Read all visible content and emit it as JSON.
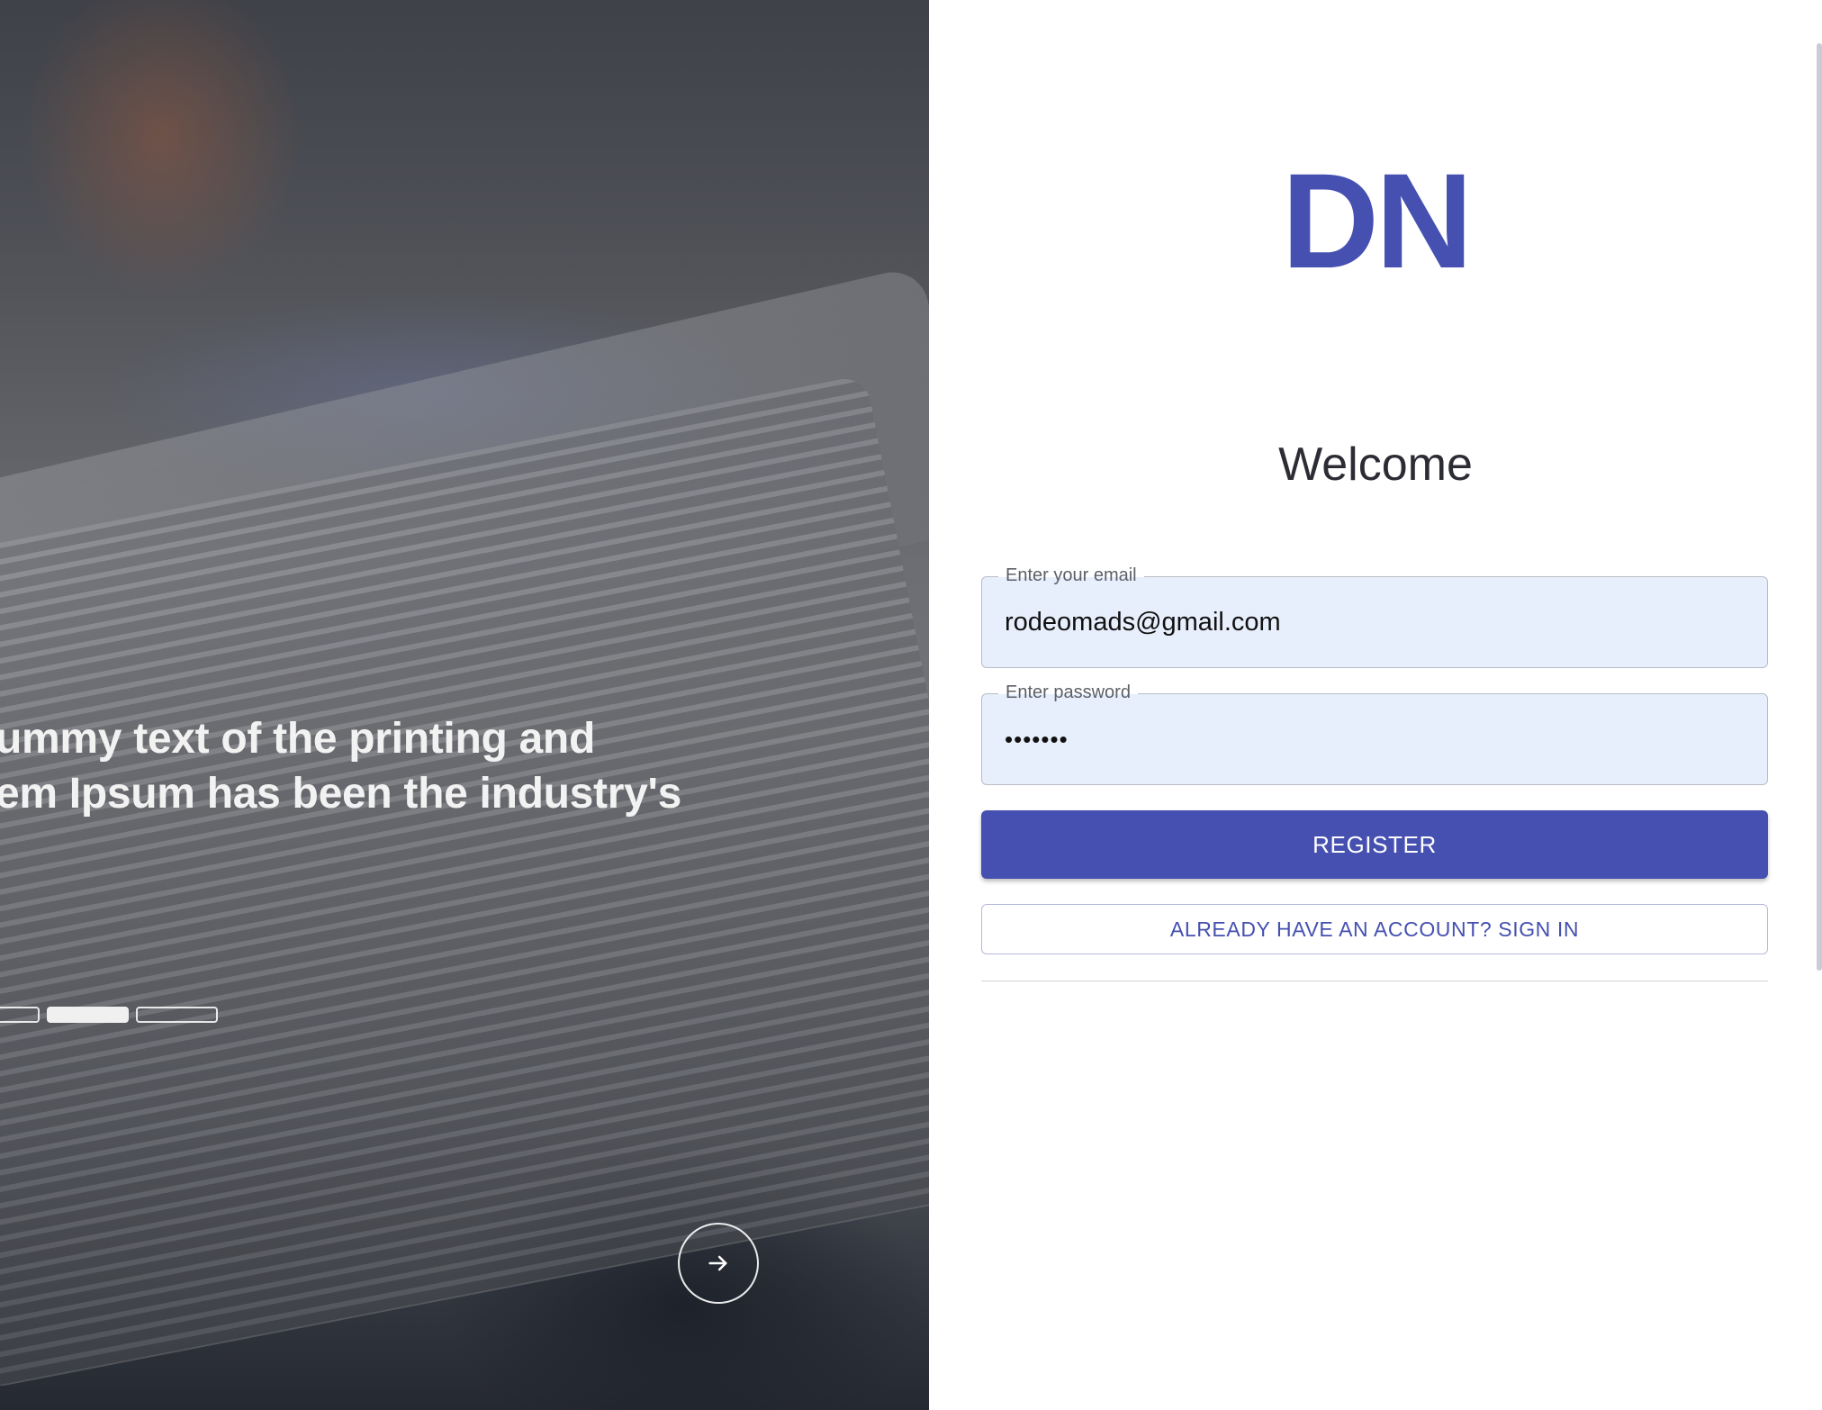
{
  "hero": {
    "text_line1": "ummy text of the printing and",
    "text_line2": "em Ipsum has been the industry's",
    "carousel": {
      "slides": 3,
      "active_index": 1
    },
    "next_icon": "arrow-right-icon"
  },
  "brand": {
    "logo_text": "DN",
    "color": "#4550b0"
  },
  "form": {
    "title": "Welcome",
    "email": {
      "label": "Enter your email",
      "value": "rodeomads@gmail.com"
    },
    "password": {
      "label": "Enter password",
      "value": "•••••••"
    },
    "register_label": "REGISTER",
    "signin_label": "ALREADY HAVE AN ACCOUNT? SIGN IN"
  },
  "colors": {
    "accent": "#4550b0",
    "input_bg": "#e8effc",
    "title": "#2c2c35"
  }
}
